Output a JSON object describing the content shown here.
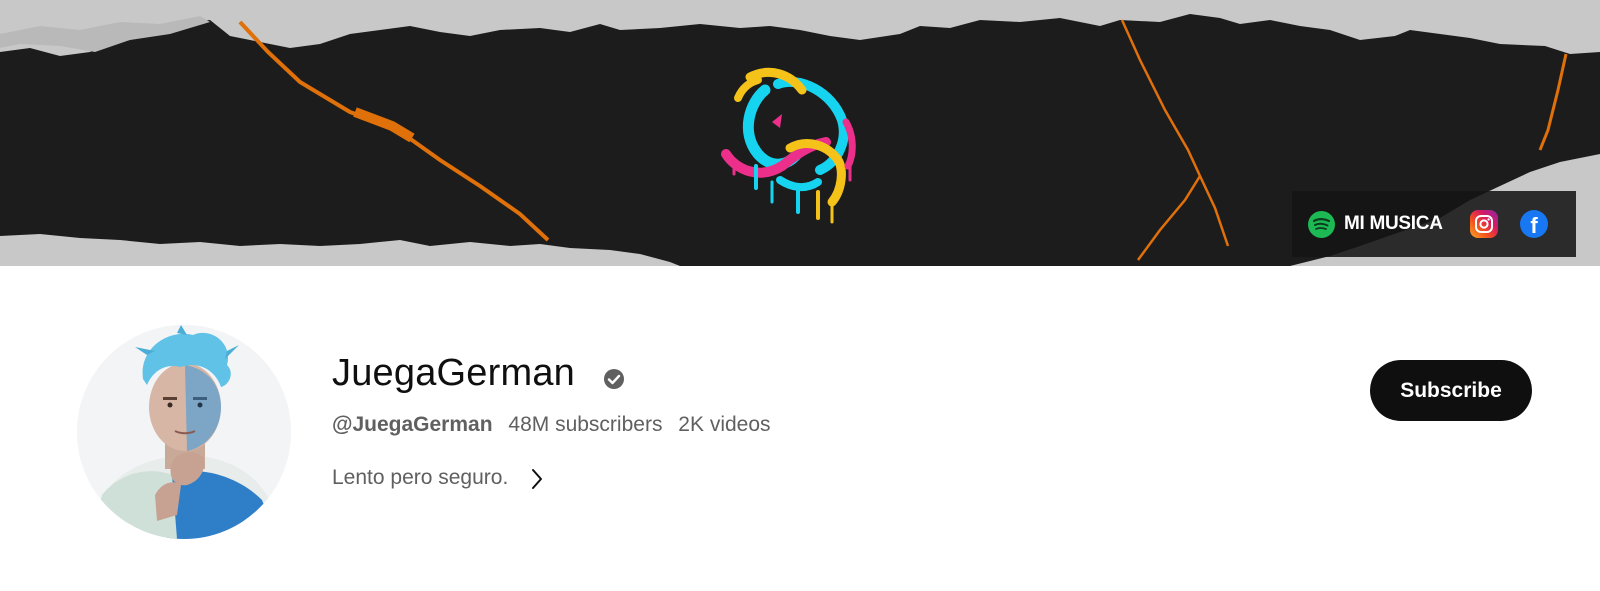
{
  "banner": {
    "links": {
      "label": "MI MUSICA",
      "icons": [
        "spotify-icon",
        "instagram-icon",
        "facebook-icon"
      ],
      "facebook_glyph": "f"
    },
    "colors": {
      "background": "#1c1c1c",
      "torn_paper": "#c8c8c8",
      "crack": "#e0700a",
      "logo_cyan": "#16d3f0",
      "logo_pink": "#ec2f8a",
      "logo_yellow": "#f5c21a"
    }
  },
  "channel": {
    "name": "JuegaGerman",
    "handle": "@JuegaGerman",
    "subscribers": "48M subscribers",
    "videos": "2K videos",
    "description": "Lento pero seguro.",
    "verified_icon": "verified-check-icon"
  },
  "subscribe": {
    "label": "Subscribe",
    "color": "#0f0f0f"
  }
}
